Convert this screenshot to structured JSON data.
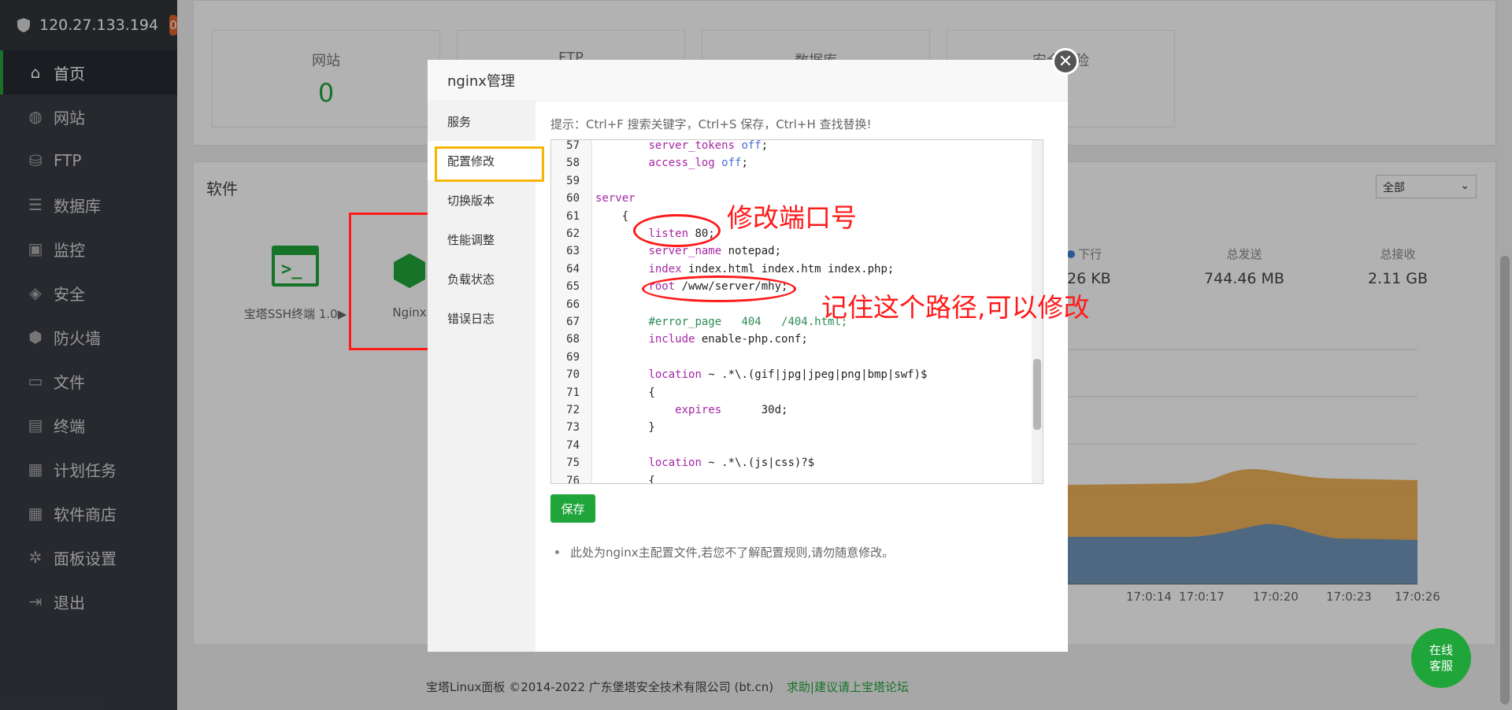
{
  "sidebar": {
    "ip": "120.27.133.194",
    "badge": "0",
    "items": [
      {
        "label": "首页",
        "icon": "home-icon"
      },
      {
        "label": "网站",
        "icon": "globe-icon"
      },
      {
        "label": "FTP",
        "icon": "ftp-icon"
      },
      {
        "label": "数据库",
        "icon": "database-icon"
      },
      {
        "label": "监控",
        "icon": "monitor-icon"
      },
      {
        "label": "安全",
        "icon": "shield-check-icon"
      },
      {
        "label": "防火墙",
        "icon": "firewall-icon"
      },
      {
        "label": "文件",
        "icon": "folder-icon"
      },
      {
        "label": "终端",
        "icon": "terminal-icon"
      },
      {
        "label": "计划任务",
        "icon": "calendar-icon"
      },
      {
        "label": "软件商店",
        "icon": "grid-icon"
      },
      {
        "label": "面板设置",
        "icon": "gear-icon"
      },
      {
        "label": "退出",
        "icon": "logout-icon"
      }
    ]
  },
  "stats": [
    {
      "label": "网站",
      "value": "0"
    },
    {
      "label": "FTP",
      "value": ""
    },
    {
      "label": "数据库",
      "value": ""
    },
    {
      "label": "安全风险",
      "value": ""
    }
  ],
  "software": {
    "title": "软件",
    "select_value": "全部",
    "cards": [
      {
        "label": "宝塔SSH终端 1.0▶"
      },
      {
        "label": "Nginx"
      }
    ]
  },
  "network": {
    "columns": [
      {
        "label": "下行",
        "value": "26 KB"
      },
      {
        "label": "总发送",
        "value": "744.46 MB"
      },
      {
        "label": "总接收",
        "value": "2.11 GB"
      }
    ],
    "ticks": [
      "17:0:14",
      "17:0:17",
      "17:0:20",
      "17:0:23",
      "17:0:26"
    ]
  },
  "footer": {
    "copyright": "宝塔Linux面板 ©2014-2022 广东堡塔安全技术有限公司 (bt.cn)",
    "link": "求助|建议请上宝塔论坛"
  },
  "chat": {
    "line1": "在线",
    "line2": "客服"
  },
  "modal": {
    "title": "nginx管理",
    "close": "✕",
    "tabs": [
      "服务",
      "配置修改",
      "切换版本",
      "性能调整",
      "负载状态",
      "错误日志"
    ],
    "hint": "提示：Ctrl+F 搜索关键字，Ctrl+S 保存，Ctrl+H 查找替换!",
    "save_label": "保存",
    "note": "此处为nginx主配置文件,若您不了解配置规则,请勿随意修改。"
  },
  "code": [
    {
      "n": "57",
      "t": "        server_tokens off;"
    },
    {
      "n": "58",
      "t": "        access_log off;"
    },
    {
      "n": "59",
      "t": ""
    },
    {
      "n": "60",
      "t": "server"
    },
    {
      "n": "61",
      "t": "    {"
    },
    {
      "n": "62",
      "t": "        listen 80;"
    },
    {
      "n": "63",
      "t": "        server_name notepad;"
    },
    {
      "n": "64",
      "t": "        index index.html index.htm index.php;"
    },
    {
      "n": "65",
      "t": "        root /www/server/mhy;"
    },
    {
      "n": "66",
      "t": ""
    },
    {
      "n": "67",
      "t": "        #error_page   404   /404.html;"
    },
    {
      "n": "68",
      "t": "        include enable-php.conf;"
    },
    {
      "n": "69",
      "t": ""
    },
    {
      "n": "70",
      "t": "        location ~ .*\\.(gif|jpg|jpeg|png|bmp|swf)$"
    },
    {
      "n": "71",
      "t": "        {"
    },
    {
      "n": "72",
      "t": "            expires      30d;"
    },
    {
      "n": "73",
      "t": "        }"
    },
    {
      "n": "74",
      "t": ""
    },
    {
      "n": "75",
      "t": "        location ~ .*\\.(js|css)?$"
    },
    {
      "n": "76",
      "t": "        {"
    }
  ],
  "annotations": {
    "port": "修改端口号",
    "path": "记住这个路径,可以修改"
  }
}
